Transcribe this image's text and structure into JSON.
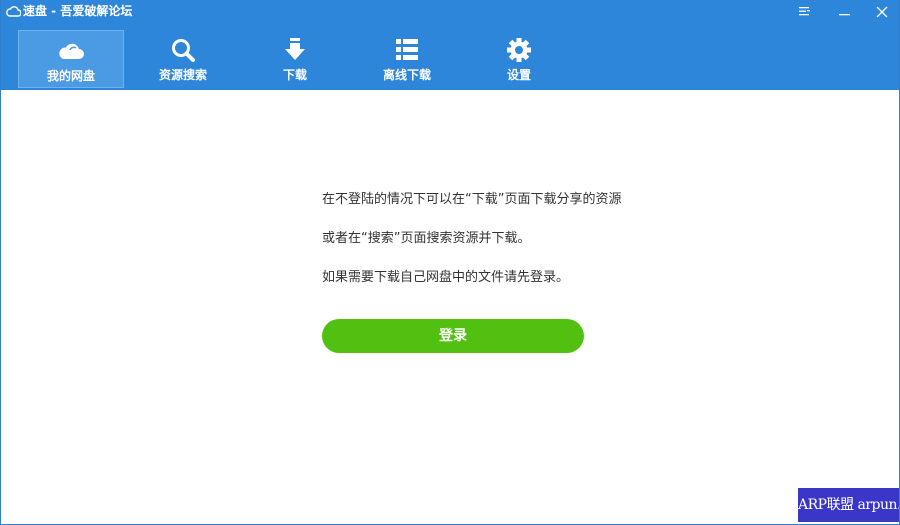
{
  "window": {
    "title": "速盘 - 吾爱破解论坛"
  },
  "nav": {
    "items": [
      {
        "label": "我的网盘",
        "icon": "cloud-icon",
        "active": true
      },
      {
        "label": "资源搜索",
        "icon": "search-icon",
        "active": false
      },
      {
        "label": "下载",
        "icon": "download-icon",
        "active": false
      },
      {
        "label": "离线下载",
        "icon": "list-icon",
        "active": false
      },
      {
        "label": "设置",
        "icon": "gear-icon",
        "active": false
      }
    ]
  },
  "main": {
    "line1": "在不登陆的情况下可以在“下载”页面下载分享的资源",
    "line2": "或者在“搜索”页面搜索资源并下载。",
    "line3": "如果需要下载自己网盘中的文件请先登录。",
    "login_label": "登录"
  },
  "watermark": {
    "text": "ARP联盟 arpun.com"
  },
  "colors": {
    "header": "#2d86d9",
    "active_tab": "#4a9ae4",
    "login_button": "#52c011",
    "watermark_bg": "#3a37c8"
  }
}
